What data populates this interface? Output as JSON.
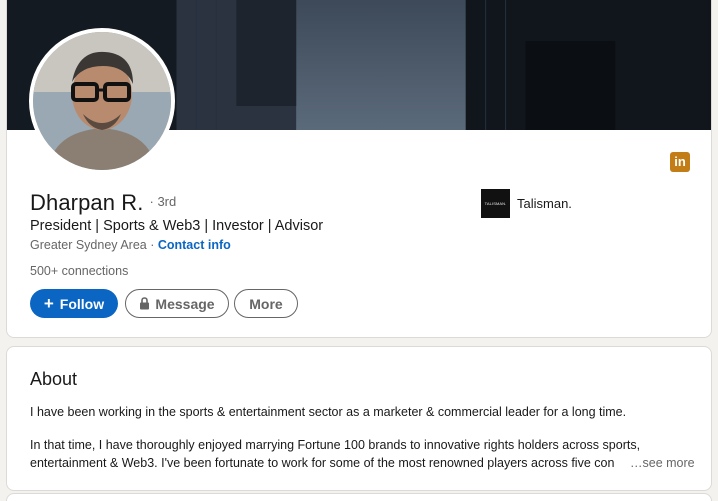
{
  "profile": {
    "name": "Dharpan R.",
    "degree": "· 3rd",
    "headline": "President | Sports & Web3 | Investor | Advisor",
    "location": "Greater Sydney Area",
    "location_sep": " · ",
    "contact_info": "Contact info",
    "connections": "500+ connections",
    "linkedin_badge": "in",
    "company": {
      "logo_text": "TALISMAN.",
      "name": "Talisman."
    }
  },
  "actions": {
    "follow_plus": "+",
    "follow_label": "Follow",
    "message_label": "Message",
    "more_label": "More"
  },
  "about": {
    "title": "About",
    "paragraph1": "I have been working in the sports & entertainment sector as a marketer & commercial leader for a long time.",
    "paragraph2_line1": "In that time, I have thoroughly enjoyed marrying Fortune 100 brands to innovative rights holders across sports,",
    "paragraph2_line2": "entertainment & Web3. I've been fortunate to work for some of the most renowned players across five con",
    "see_more": "…see more"
  },
  "colors": {
    "accent": "#0a66c2",
    "linkedin_badge": "#c37d16",
    "page_bg": "#f3f2ef"
  }
}
